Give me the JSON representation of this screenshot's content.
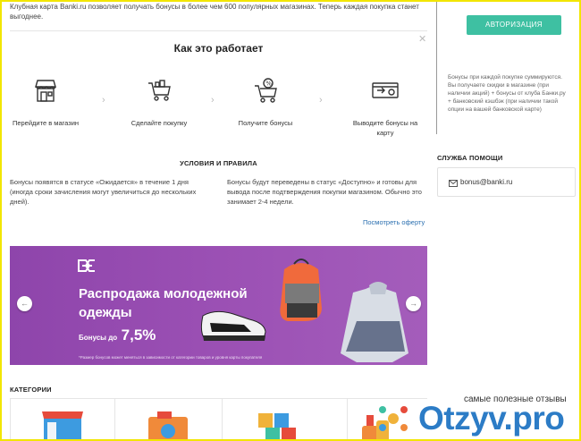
{
  "intro_text": "Клубная карта Banki.ru позволяет получать бонусы в более чем 600 популярных магазинах. Теперь каждая покупка станет выгоднее.",
  "how_it_works": {
    "title": "Как это работает",
    "steps": [
      {
        "label": "Перейдите в магазин",
        "icon": "store-icon"
      },
      {
        "label": "Сделайте покупку",
        "icon": "cart-icon"
      },
      {
        "label": "Получите бонусы",
        "icon": "cart-percent-icon"
      },
      {
        "label": "Выводите бонусы на карту",
        "icon": "card-withdraw-icon"
      }
    ]
  },
  "rules": {
    "title": "УСЛОВИЯ И ПРАВИЛА",
    "left": "Бонусы появятся в статусе «Ожидается» в течение 1 дня (иногда сроки зачисления могут увеличиться до нескольких дней).",
    "right": "Бонусы будут переведены в статус «Доступно» и готовы для вывода после подтверждения покупки магазином. Обычно это занимает 2-4 недели.",
    "offer_link": "Посмотреть оферту"
  },
  "banner": {
    "title": "Распродажа молодежной одежды",
    "bonus_prefix": "Бонусы до",
    "bonus_value": "7,5%",
    "fine_print": "*Размер бонусов может меняться в зависимости от категории товаров и уровня карты покупателя",
    "color": "#9b50b4"
  },
  "categories": {
    "title": "КАТЕГОРИИ"
  },
  "sidebar": {
    "auth_button": "АВТОРИЗАЦИЯ",
    "info": "Бонусы при каждой покупке суммируются. Вы получаете скидки в магазине (при наличии акций) + бонусы от клуба Банки.ру + банковский кэшбэк (при наличии такой опции на вашей банковской карте)",
    "help_title": "СЛУЖБА ПОМОЩИ",
    "email": "bonus@banki.ru",
    "accent": "#3ec0a2"
  },
  "watermark": {
    "tagline": "самые полезные отзывы",
    "logo": "Otzyv.pro"
  }
}
